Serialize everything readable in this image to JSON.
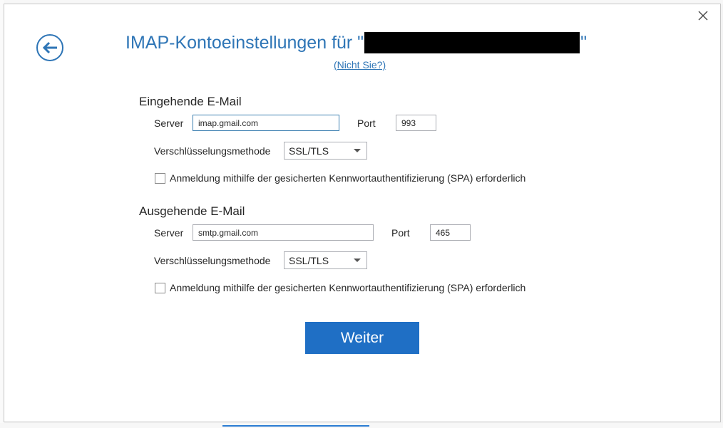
{
  "dialog": {
    "title_prefix": "IMAP-Kontoeinstellungen für \"",
    "title_suffix": "\"",
    "not_you_link": "(Nicht Sie?)",
    "close_icon": "close-icon",
    "back_icon": "arrow-left-icon"
  },
  "incoming": {
    "heading": "Eingehende E-Mail",
    "server_label": "Server",
    "server_value": "imap.gmail.com",
    "port_label": "Port",
    "port_value": "993",
    "encryption_label": "Verschlüsselungsmethode",
    "encryption_value": "SSL/TLS",
    "spa_label": "Anmeldung mithilfe der gesicherten Kennwortauthentifizierung (SPA) erforderlich",
    "spa_checked": false
  },
  "outgoing": {
    "heading": "Ausgehende E-Mail",
    "server_label": "Server",
    "server_value": "smtp.gmail.com",
    "port_label": "Port",
    "port_value": "465",
    "encryption_label": "Verschlüsselungsmethode",
    "encryption_value": "SSL/TLS",
    "spa_label": "Anmeldung mithilfe der gesicherten Kennwortauthentifizierung (SPA) erforderlich",
    "spa_checked": false
  },
  "actions": {
    "next_label": "Weiter"
  },
  "colors": {
    "accent": "#2e75b6",
    "primary_button": "#1f6fc5"
  }
}
